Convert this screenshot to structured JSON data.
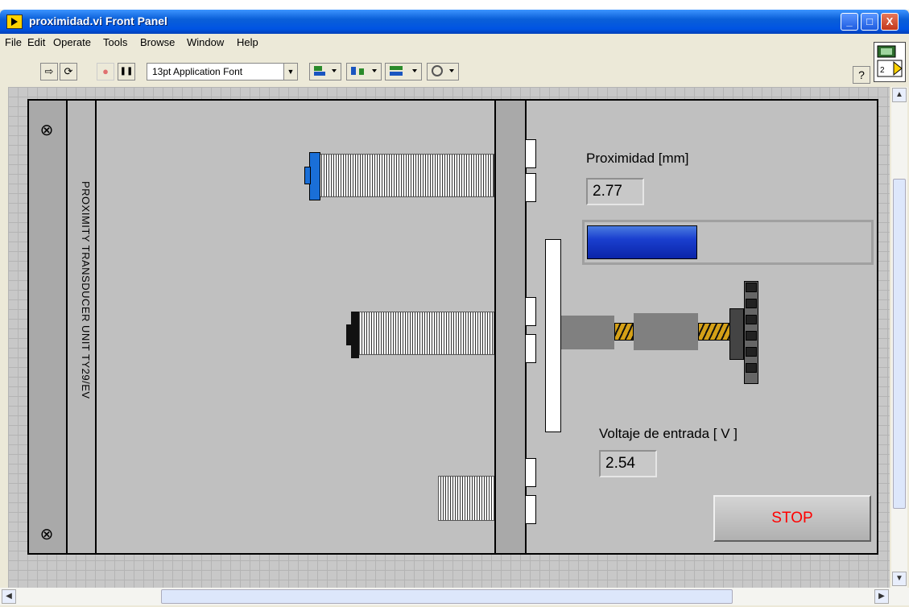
{
  "window": {
    "title": "proximidad.vi Front Panel"
  },
  "titlebar_buttons": {
    "minimize": "_",
    "maximize": "□",
    "close": "X"
  },
  "menu": {
    "items": [
      "File",
      "Edit",
      "Operate",
      "Tools",
      "Browse",
      "Window",
      "Help"
    ]
  },
  "toolbar": {
    "run_icon": "⇨",
    "run_continuous_icon": "⟳",
    "abort_icon": "●",
    "pause_icon": "❚❚",
    "font": "13pt Application Font",
    "font_arrow": "▼",
    "align_icon": "align-objects-icon",
    "distribute_icon": "distribute-objects-icon",
    "resize_icon": "resize-objects-icon",
    "reorder_icon": "reorder-icon",
    "help": "?"
  },
  "panel": {
    "vertical_label": "PROXIMITY TRANSDUCER UNIT TY29/EV",
    "screw_symbol": "⊗"
  },
  "proximity": {
    "label": "Proximidad [mm]",
    "value": "2.77",
    "bar_fraction": 0.39
  },
  "voltage": {
    "label": "Voltaje de entrada [ V ]",
    "value": "2.54"
  },
  "stop": {
    "label": "STOP"
  },
  "scroll": {
    "up": "▲",
    "down": "▼",
    "left": "◀",
    "right": "▶"
  },
  "colors": {
    "bar_fill": "#1a3fcf",
    "stop_text": "#ff0000",
    "thread": "#d4a017"
  }
}
